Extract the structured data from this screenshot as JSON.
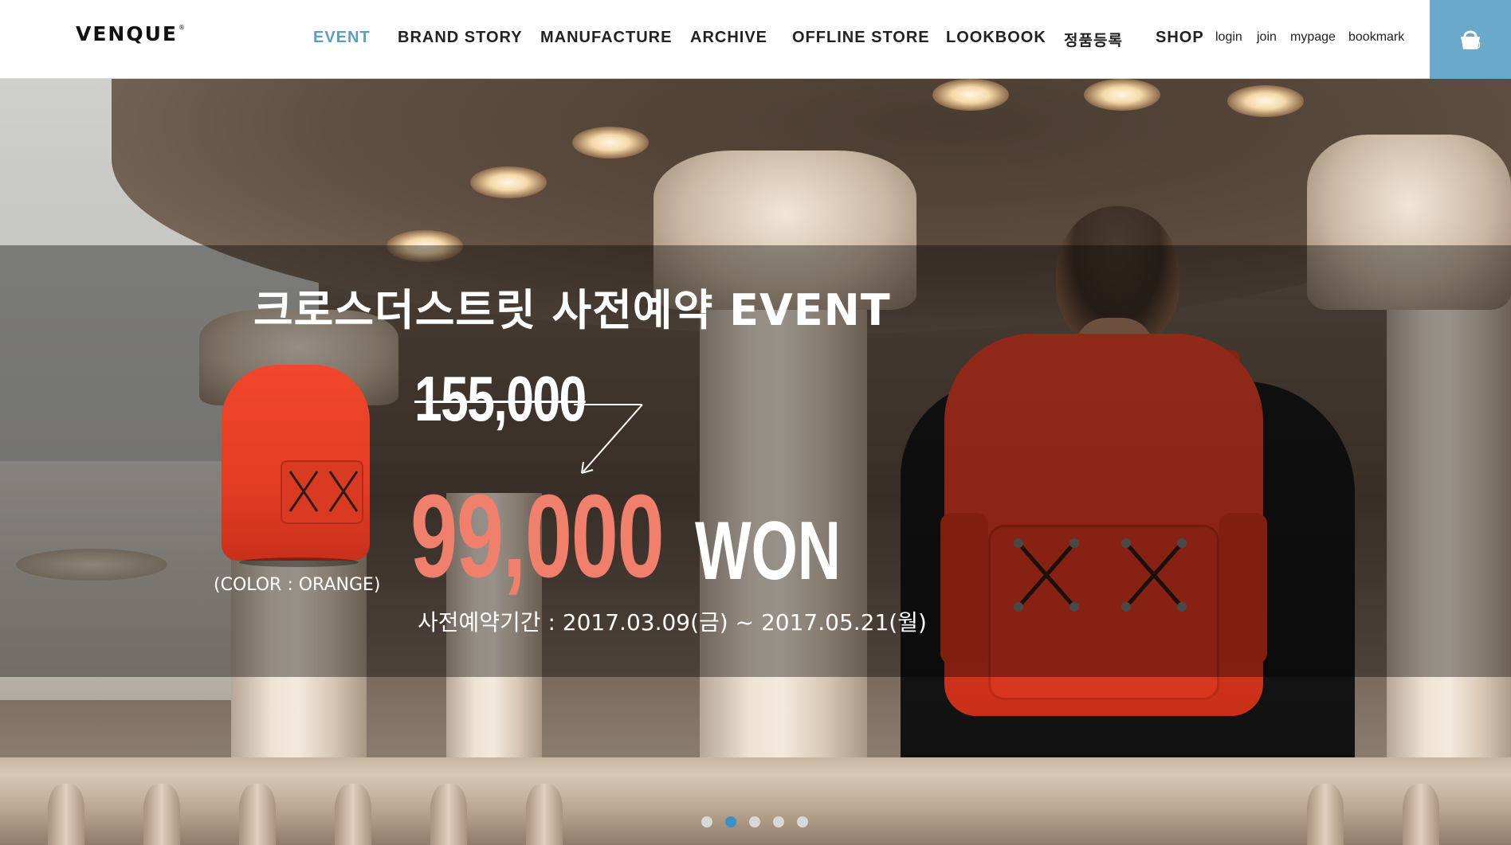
{
  "header": {
    "logo": "VENQUE",
    "logo_mark": "®",
    "nav": [
      {
        "label": "EVENT",
        "active": true
      },
      {
        "label": "BRAND STORY",
        "active": false
      },
      {
        "label": "MANUFACTURE",
        "active": false
      },
      {
        "label": "ARCHIVE",
        "active": false
      },
      {
        "label": "OFFLINE STORE",
        "active": false
      },
      {
        "label": "LOOKBOOK",
        "active": false
      },
      {
        "label": "정품등록",
        "active": false
      },
      {
        "label": "SHOP",
        "active": false
      }
    ],
    "utility": [
      "login",
      "join",
      "mypage",
      "bookmark"
    ],
    "cart_count": "0",
    "cart_icon": "shopping-basket-icon",
    "accent_color": "#6aa9c9",
    "active_nav_color": "#5b9ec0"
  },
  "hero": {
    "title": "크로스더스트릿 사전예약 EVENT",
    "original_price": "155,000",
    "sale_price": "99,000",
    "currency": "WON",
    "product_color": "(COLOR : ORANGE)",
    "period": "사전예약기간 : 2017.03.09(금) ~ 2017.05.21(월)",
    "sale_price_color": "#f07f6b",
    "slides_total": 5,
    "slides_active": 2
  }
}
